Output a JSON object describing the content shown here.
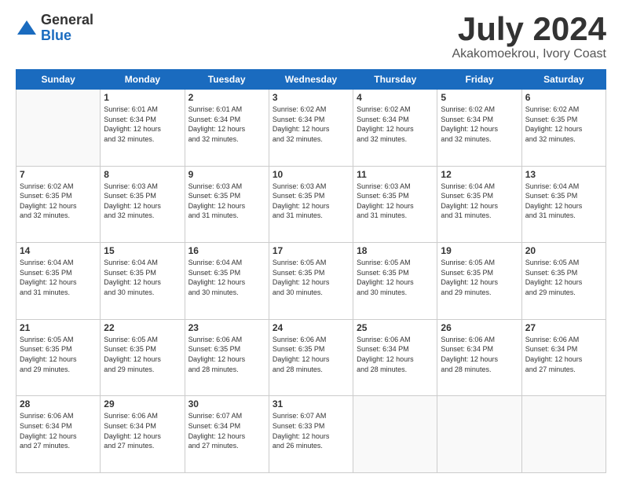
{
  "header": {
    "logo_line1": "General",
    "logo_line2": "Blue",
    "month": "July 2024",
    "location": "Akakomoekrou, Ivory Coast"
  },
  "weekdays": [
    "Sunday",
    "Monday",
    "Tuesday",
    "Wednesday",
    "Thursday",
    "Friday",
    "Saturday"
  ],
  "weeks": [
    [
      {
        "day": "",
        "info": ""
      },
      {
        "day": "1",
        "info": "Sunrise: 6:01 AM\nSunset: 6:34 PM\nDaylight: 12 hours\nand 32 minutes."
      },
      {
        "day": "2",
        "info": "Sunrise: 6:01 AM\nSunset: 6:34 PM\nDaylight: 12 hours\nand 32 minutes."
      },
      {
        "day": "3",
        "info": "Sunrise: 6:02 AM\nSunset: 6:34 PM\nDaylight: 12 hours\nand 32 minutes."
      },
      {
        "day": "4",
        "info": "Sunrise: 6:02 AM\nSunset: 6:34 PM\nDaylight: 12 hours\nand 32 minutes."
      },
      {
        "day": "5",
        "info": "Sunrise: 6:02 AM\nSunset: 6:34 PM\nDaylight: 12 hours\nand 32 minutes."
      },
      {
        "day": "6",
        "info": "Sunrise: 6:02 AM\nSunset: 6:35 PM\nDaylight: 12 hours\nand 32 minutes."
      }
    ],
    [
      {
        "day": "7",
        "info": "Sunrise: 6:02 AM\nSunset: 6:35 PM\nDaylight: 12 hours\nand 32 minutes."
      },
      {
        "day": "8",
        "info": "Sunrise: 6:03 AM\nSunset: 6:35 PM\nDaylight: 12 hours\nand 32 minutes."
      },
      {
        "day": "9",
        "info": "Sunrise: 6:03 AM\nSunset: 6:35 PM\nDaylight: 12 hours\nand 31 minutes."
      },
      {
        "day": "10",
        "info": "Sunrise: 6:03 AM\nSunset: 6:35 PM\nDaylight: 12 hours\nand 31 minutes."
      },
      {
        "day": "11",
        "info": "Sunrise: 6:03 AM\nSunset: 6:35 PM\nDaylight: 12 hours\nand 31 minutes."
      },
      {
        "day": "12",
        "info": "Sunrise: 6:04 AM\nSunset: 6:35 PM\nDaylight: 12 hours\nand 31 minutes."
      },
      {
        "day": "13",
        "info": "Sunrise: 6:04 AM\nSunset: 6:35 PM\nDaylight: 12 hours\nand 31 minutes."
      }
    ],
    [
      {
        "day": "14",
        "info": "Sunrise: 6:04 AM\nSunset: 6:35 PM\nDaylight: 12 hours\nand 31 minutes."
      },
      {
        "day": "15",
        "info": "Sunrise: 6:04 AM\nSunset: 6:35 PM\nDaylight: 12 hours\nand 30 minutes."
      },
      {
        "day": "16",
        "info": "Sunrise: 6:04 AM\nSunset: 6:35 PM\nDaylight: 12 hours\nand 30 minutes."
      },
      {
        "day": "17",
        "info": "Sunrise: 6:05 AM\nSunset: 6:35 PM\nDaylight: 12 hours\nand 30 minutes."
      },
      {
        "day": "18",
        "info": "Sunrise: 6:05 AM\nSunset: 6:35 PM\nDaylight: 12 hours\nand 30 minutes."
      },
      {
        "day": "19",
        "info": "Sunrise: 6:05 AM\nSunset: 6:35 PM\nDaylight: 12 hours\nand 29 minutes."
      },
      {
        "day": "20",
        "info": "Sunrise: 6:05 AM\nSunset: 6:35 PM\nDaylight: 12 hours\nand 29 minutes."
      }
    ],
    [
      {
        "day": "21",
        "info": "Sunrise: 6:05 AM\nSunset: 6:35 PM\nDaylight: 12 hours\nand 29 minutes."
      },
      {
        "day": "22",
        "info": "Sunrise: 6:05 AM\nSunset: 6:35 PM\nDaylight: 12 hours\nand 29 minutes."
      },
      {
        "day": "23",
        "info": "Sunrise: 6:06 AM\nSunset: 6:35 PM\nDaylight: 12 hours\nand 28 minutes."
      },
      {
        "day": "24",
        "info": "Sunrise: 6:06 AM\nSunset: 6:35 PM\nDaylight: 12 hours\nand 28 minutes."
      },
      {
        "day": "25",
        "info": "Sunrise: 6:06 AM\nSunset: 6:34 PM\nDaylight: 12 hours\nand 28 minutes."
      },
      {
        "day": "26",
        "info": "Sunrise: 6:06 AM\nSunset: 6:34 PM\nDaylight: 12 hours\nand 28 minutes."
      },
      {
        "day": "27",
        "info": "Sunrise: 6:06 AM\nSunset: 6:34 PM\nDaylight: 12 hours\nand 27 minutes."
      }
    ],
    [
      {
        "day": "28",
        "info": "Sunrise: 6:06 AM\nSunset: 6:34 PM\nDaylight: 12 hours\nand 27 minutes."
      },
      {
        "day": "29",
        "info": "Sunrise: 6:06 AM\nSunset: 6:34 PM\nDaylight: 12 hours\nand 27 minutes."
      },
      {
        "day": "30",
        "info": "Sunrise: 6:07 AM\nSunset: 6:34 PM\nDaylight: 12 hours\nand 27 minutes."
      },
      {
        "day": "31",
        "info": "Sunrise: 6:07 AM\nSunset: 6:33 PM\nDaylight: 12 hours\nand 26 minutes."
      },
      {
        "day": "",
        "info": ""
      },
      {
        "day": "",
        "info": ""
      },
      {
        "day": "",
        "info": ""
      }
    ]
  ]
}
